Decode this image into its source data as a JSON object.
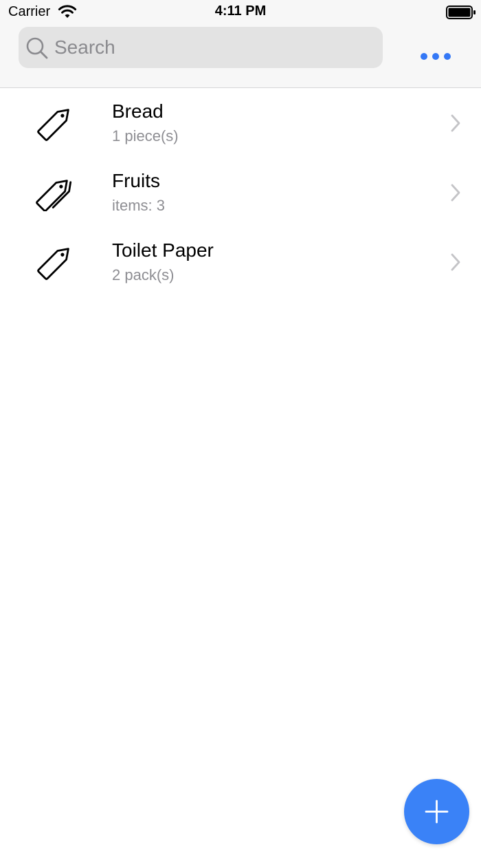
{
  "status_bar": {
    "carrier": "Carrier",
    "time": "4:11 PM",
    "wifi_icon": "wifi-icon",
    "battery_icon": "battery-full-icon"
  },
  "search": {
    "placeholder": "Search",
    "value": "",
    "icon": "search-icon"
  },
  "header": {
    "more_icon": "ellipsis-icon"
  },
  "items": [
    {
      "title": "Bread",
      "subtitle": "1 piece(s)",
      "icon": "tag-icon"
    },
    {
      "title": "Fruits",
      "subtitle": "items: 3",
      "icon": "tags-icon"
    },
    {
      "title": "Toilet Paper",
      "subtitle": "2 pack(s)",
      "icon": "tag-icon"
    }
  ],
  "fab": {
    "icon": "plus-icon"
  },
  "colors": {
    "accent": "#3478f6",
    "fab": "#3a82f7",
    "secondary_text": "#8e8e93",
    "search_bg": "#e3e3e3",
    "header_bg": "#f7f7f7"
  }
}
